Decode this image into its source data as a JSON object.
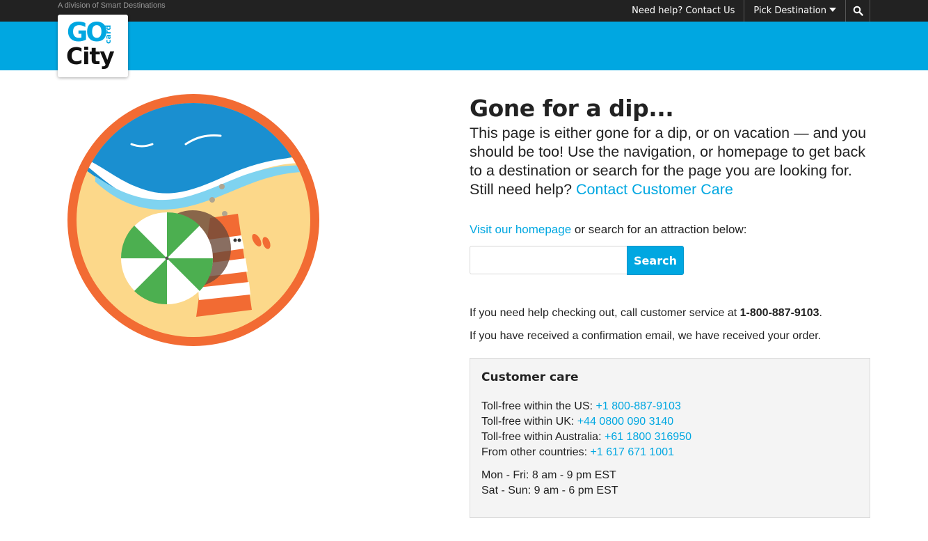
{
  "header": {
    "division_text": "A division of Smart Destinations",
    "nav": {
      "contact": "Need help? Contact Us",
      "pick_destination": "Pick Destination"
    },
    "logo": {
      "go": "GO",
      "card": "card",
      "city": "City"
    }
  },
  "main": {
    "title": "Gone for a dip...",
    "intro_text": "This page is either gone for a dip, or on vacation — and you should be too! Use the navigation, or homepage to get back to a destination or search for the page you are looking for. Still need help?",
    "intro_link": "Contact Customer Care",
    "visit_link": "Visit our homepage",
    "visit_text": "or search for an attraction below:",
    "search": {
      "value": "",
      "button_label": "Search"
    },
    "help_text_before": "If you need help checking out, call customer service at",
    "help_phone": "1-800-887-9103",
    "help_text_after": ".",
    "confirmation_text": "If you have received a confirmation email, we have received your order."
  },
  "customer_care": {
    "heading": "Customer care",
    "lines": [
      {
        "label": "Toll-free within the US:",
        "phone": "+1 800-887-9103"
      },
      {
        "label": "Toll-free within UK:",
        "phone": "+44 0800 090 3140"
      },
      {
        "label": "Toll-free within Australia:",
        "phone": "+61 1800 316950"
      },
      {
        "label": "From other countries:",
        "phone": "+1 617 671 1001"
      }
    ],
    "hours": [
      "Mon - Fri: 8 am - 9 pm EST",
      "Sat - Sun: 9 am - 6 pm EST"
    ]
  },
  "colors": {
    "brand_blue": "#00a7e1",
    "top_bar": "#222222",
    "illustration_ring": "#f26b33",
    "sand": "#fcd88a",
    "umbrella_green": "#4caf50"
  }
}
